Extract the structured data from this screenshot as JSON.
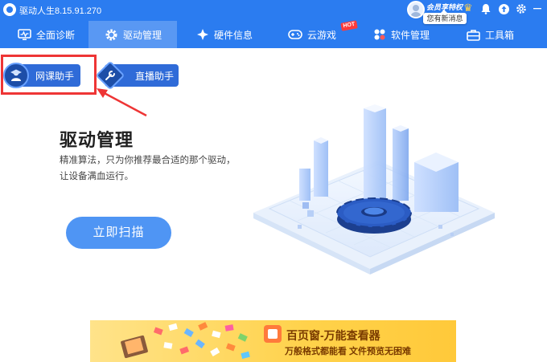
{
  "app": {
    "title": "驱动人生8.15.91.270",
    "vip_label": "会员享特权",
    "message_bubble": "您有新消息"
  },
  "nav": {
    "items": [
      {
        "label": "全面诊断",
        "icon": "monitor-icon"
      },
      {
        "label": "驱动管理",
        "icon": "gear-icon"
      },
      {
        "label": "硬件信息",
        "icon": "chip-icon"
      },
      {
        "label": "云游戏",
        "icon": "gamepad-icon"
      },
      {
        "label": "软件管理",
        "icon": "apps-icon"
      },
      {
        "label": "工具箱",
        "icon": "toolbox-icon"
      }
    ],
    "active_index": 1,
    "hot_badge": "HOT"
  },
  "helpers": {
    "course_label": "网课助手",
    "live_label": "直播助手"
  },
  "main": {
    "title": "驱动管理",
    "description_line1": "精准算法，只为你推荐最合适的那个驱动，",
    "description_line2": "让设备满血运行。",
    "scan_button": "立即扫描"
  },
  "banner": {
    "title": "百页窗-万能查看器",
    "subtitle": "万般格式都能看  文件预览无困难"
  },
  "colors": {
    "brand": "#2b7cf0",
    "scan_button": "#4f95f4",
    "highlight": "#ee3535"
  }
}
